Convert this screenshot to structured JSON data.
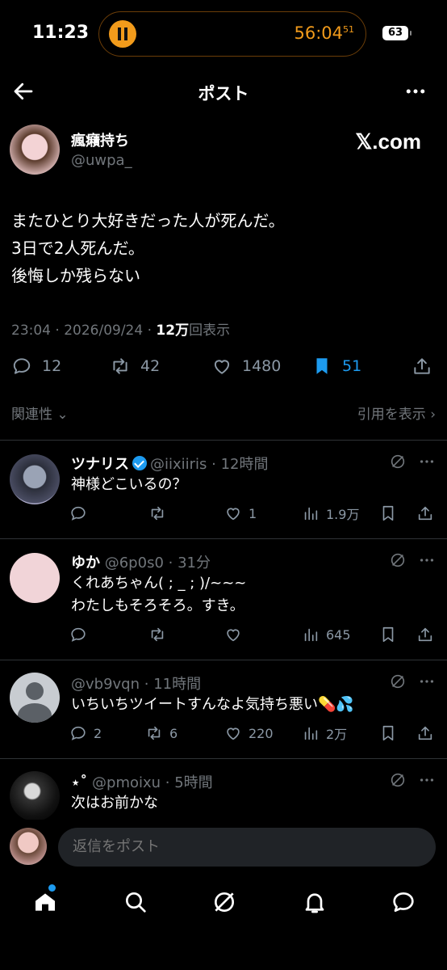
{
  "status": {
    "time": "11:23",
    "timer": "56:04",
    "timer_sub": "51",
    "battery": "63"
  },
  "nav": {
    "title": "ポスト"
  },
  "post": {
    "author_name": "瘋癪持ち",
    "author_handle": "@uwpa_",
    "brand": "𝕏.com",
    "lines": [
      "またひとり大好きだった人が死んだ。",
      "3日で2人死んだ。",
      "後悔しか残らない"
    ],
    "meta_prefix": "23:04 · 2026/09/24 · ",
    "views_count": "12万",
    "views_label": "回表示",
    "replies": "12",
    "reposts": "42",
    "likes": "1480",
    "bookmarks": "51"
  },
  "sort": {
    "label": "関連性",
    "quotes": "引用を表示"
  },
  "replies": [
    {
      "name": "ツナリス",
      "handle": "@iixiiris",
      "time": "12時間",
      "text": [
        "神様どこいるの？"
      ],
      "replies": "",
      "reposts": "",
      "likes": "1",
      "views": "1.9万"
    },
    {
      "name": "ゆか",
      "handle": "@6p0s0",
      "time": "31分",
      "text": [
        "くれあちゃん( ; _ ; )/~~~",
        "わたしもそろそろ。すき。"
      ],
      "replies": "",
      "reposts": "",
      "likes": "",
      "views": "645"
    },
    {
      "name": "",
      "handle": "@vb9vqn",
      "time": "11時間",
      "text": [
        "いちいちツイートすんなよ気持ち悪い💊💦"
      ],
      "replies": "2",
      "reposts": "6",
      "likes": "220",
      "views": "2万"
    },
    {
      "name": "⋆˚",
      "handle": "@pmoixu",
      "time": "5時間",
      "text": [
        "次はお前かな"
      ],
      "replies": "",
      "reposts": "",
      "likes": "",
      "views": ""
    }
  ],
  "composer": {
    "placeholder": "返信をポスト"
  },
  "colors": {
    "accent": "#1d9bf0",
    "timer": "#f29b1b",
    "muted": "#71767b"
  },
  "icons": [
    "back-arrow-icon",
    "more-icon",
    "reply-icon",
    "repost-icon",
    "like-icon",
    "bookmark-icon",
    "share-icon",
    "views-icon",
    "grok-icon",
    "home-icon",
    "search-icon",
    "notifications-icon",
    "messages-icon"
  ]
}
